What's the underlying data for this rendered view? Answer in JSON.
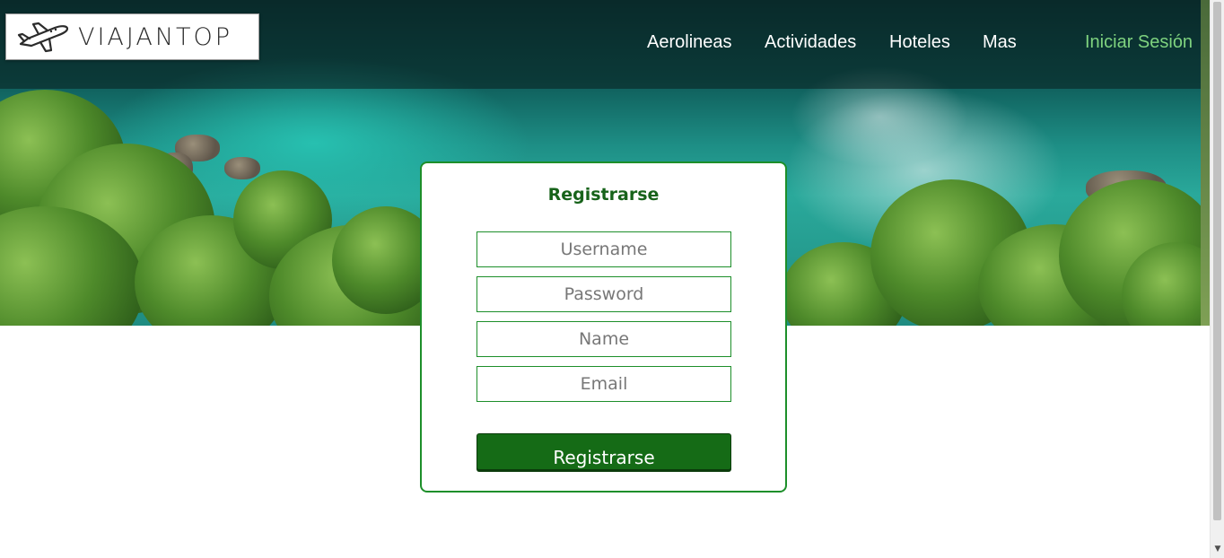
{
  "brand": {
    "name": "VIAJANTOP",
    "logo_icon": "airplane-icon"
  },
  "nav": {
    "items": [
      {
        "label": "Aerolineas"
      },
      {
        "label": "Actividades"
      },
      {
        "label": "Hoteles"
      },
      {
        "label": "Mas"
      }
    ],
    "login_label": "Iniciar Sesión"
  },
  "register_form": {
    "title": "Registrarse",
    "username_placeholder": "Username",
    "password_placeholder": "Password",
    "name_placeholder": "Name",
    "email_placeholder": "Email",
    "submit_label": "Registrarse"
  },
  "colors": {
    "accent_green": "#156b16",
    "border_green": "#1d8f2a",
    "login_link": "#7fd37f"
  }
}
